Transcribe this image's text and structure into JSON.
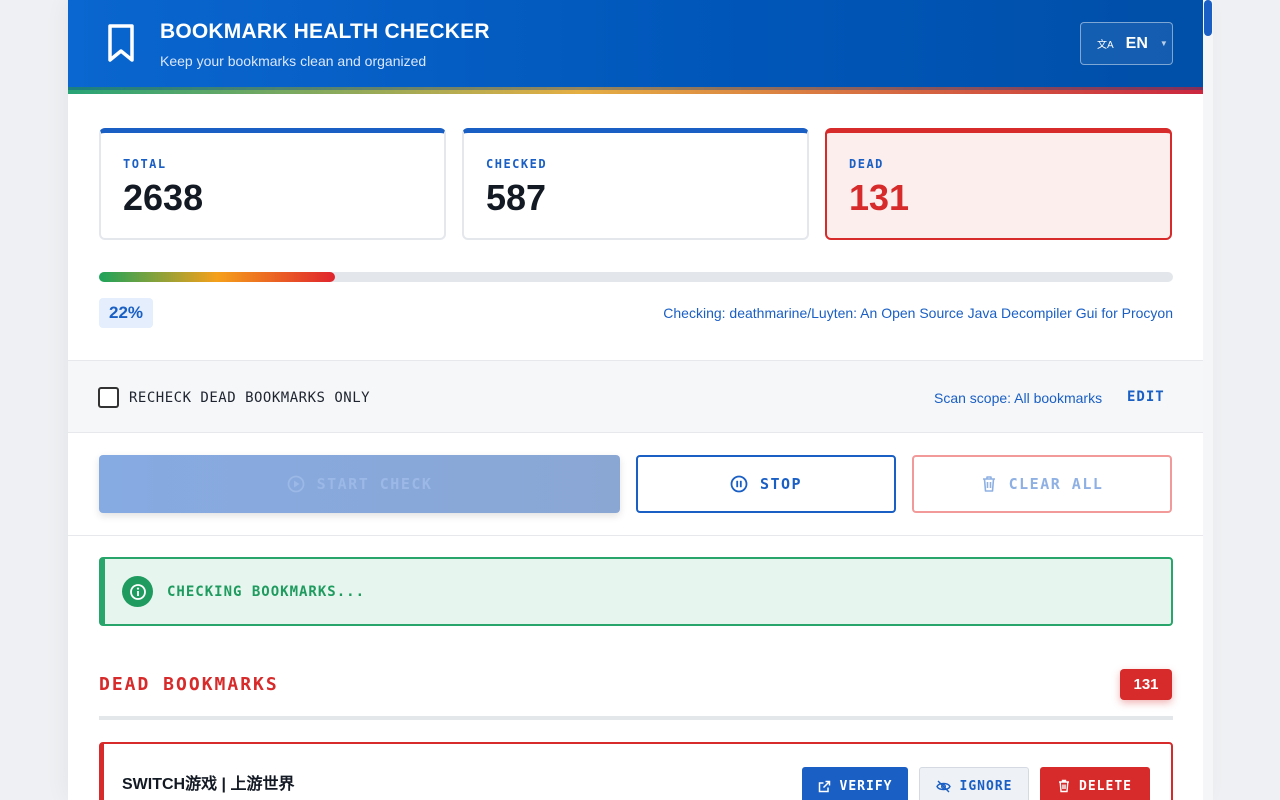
{
  "header": {
    "title": "BOOKMARK HEALTH CHECKER",
    "subtitle": "Keep your bookmarks clean and organized",
    "language": "EN",
    "language_icon": "translate-icon"
  },
  "stats": [
    {
      "label": "TOTAL",
      "value": "2638"
    },
    {
      "label": "CHECKED",
      "value": "587"
    },
    {
      "label": "DEAD",
      "value": "131"
    }
  ],
  "progress": {
    "fraction": 0.22,
    "percent_label": "22%",
    "checking_text": "Checking: deathmarine/Luyten: An Open Source Java Decompiler Gui for Procyon"
  },
  "options": {
    "recheck_label": "RECHECK DEAD BOOKMARKS ONLY",
    "recheck_checked": false,
    "scope_text": "Scan scope: All bookmarks",
    "edit_label": "EDIT"
  },
  "actions": {
    "start_label": "START CHECK",
    "stop_label": "STOP",
    "clear_label": "CLEAR ALL"
  },
  "status": {
    "text": "CHECKING BOOKMARKS...",
    "icon": "info-icon"
  },
  "dead_section": {
    "title": "DEAD BOOKMARKS",
    "count": "131",
    "items": [
      {
        "title": "SWITCH游戏 | 上游世界",
        "verify_label": "VERIFY",
        "ignore_label": "IGNORE",
        "delete_label": "DELETE"
      }
    ]
  },
  "colors": {
    "primary": "#1a5fc4",
    "danger": "#d72a2a",
    "success": "#1f9b5f"
  }
}
